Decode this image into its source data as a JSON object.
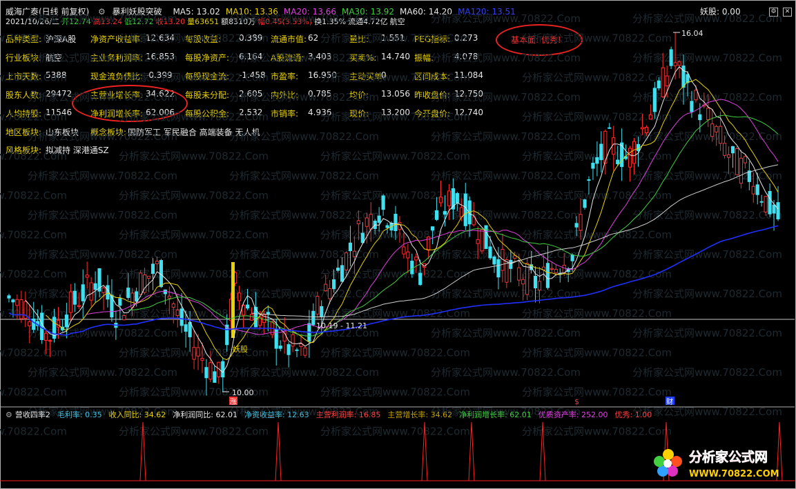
{
  "window": {
    "title": "威海广泰(日线 前复权)",
    "indicator_name": "暴利妖股突破",
    "ma_values": [
      {
        "label": "MA5: 13.02",
        "color": "#e8e8e8"
      },
      {
        "label": "MA10: 13.36",
        "color": "#e8d200"
      },
      {
        "label": "MA20: 13.66",
        "color": "#e040e0"
      },
      {
        "label": "MA30: 13.92",
        "color": "#40d040"
      },
      {
        "label": "MA60: 14.20",
        "color": "#e8e8e8"
      },
      {
        "label": "MA120: 13.51",
        "color": "#3040ff"
      }
    ],
    "yaogu_label": "妖股: 0.00"
  },
  "quote_line": [
    {
      "text": "2021/10/26/二",
      "color": "#e8e8e8"
    },
    {
      "text": "开12.74",
      "color": "#40d040"
    },
    {
      "text": "高13.24",
      "color": "#ff3030"
    },
    {
      "text": "低12.72",
      "color": "#40d040"
    },
    {
      "text": "收13.20",
      "color": "#ff3030"
    },
    {
      "text": "量63651",
      "color": "#e8d200"
    },
    {
      "text": "额8310万",
      "color": "#e8e8e8"
    },
    {
      "text": "幅0.45(3.53%)",
      "color": "#ff3030"
    },
    {
      "text": "换1.35%",
      "color": "#e8e8e8"
    },
    {
      "text": "流通4.72亿",
      "color": "#e8e8e8"
    },
    {
      "text": "航空",
      "color": "#e8e8e8"
    }
  ],
  "fundamentals": {
    "col1": [
      {
        "label": "品种类型:",
        "value": "沪深A股"
      },
      {
        "label": "行业板块:",
        "value": "航空"
      },
      {
        "label": "上市天数:",
        "value": "5388"
      },
      {
        "label": "股东人数:",
        "value": "29472"
      },
      {
        "label": "人均持股:",
        "value": "11546"
      }
    ],
    "col2": [
      {
        "label": "净资产收益率:",
        "value": "12.634"
      },
      {
        "label": "主业务利润率:",
        "value": "16.853"
      },
      {
        "label": "现金流负债比:",
        "value": "-0.399"
      },
      {
        "label": "主营业增长率:",
        "value": "34.622"
      },
      {
        "label": "净利润增长率:",
        "value": "62.006"
      }
    ],
    "col3": [
      {
        "label": "每股收益:",
        "value": "0.389"
      },
      {
        "label": "每股净资产:",
        "value": "6.164"
      },
      {
        "label": "每股现金流:",
        "value": "-1.458"
      },
      {
        "label": "每股未分配:",
        "value": "2.605"
      },
      {
        "label": "每股公积金:",
        "value": "2.532"
      }
    ],
    "col4": [
      {
        "label": "流通市值:",
        "value": "62"
      },
      {
        "label": "A股流通:",
        "value": "3.403"
      },
      {
        "label": "市盈率:",
        "value": "16.950"
      },
      {
        "label": "内外比:",
        "value": "0.785"
      },
      {
        "label": "市销率:",
        "value": "4.936"
      }
    ],
    "col5": [
      {
        "label": "量比:",
        "value": "1.551"
      },
      {
        "label": "买卖%:",
        "value": "14.740"
      },
      {
        "label": "主动买单:",
        "value": "0"
      },
      {
        "label": "均价:",
        "value": "13.056"
      },
      {
        "label": "现价:",
        "value": "13.200"
      }
    ],
    "col6": [
      {
        "label": "PEG指标:",
        "value": "0.273"
      },
      {
        "label": "振幅:",
        "value": "4.078"
      },
      {
        "label": "区间成本:",
        "value": "11.084"
      },
      {
        "label": "昨收盘价:",
        "value": "12.750"
      },
      {
        "label": "今开盘价:",
        "value": "12.740"
      }
    ],
    "region": {
      "label": "地区板块:",
      "value": "山东板块"
    },
    "concept": {
      "label": "概念板块:",
      "value": "国防军工 军民融合 高端装备 无人机"
    },
    "style": {
      "label": "风格板块:",
      "value": "拟减持 深港通SZ"
    },
    "verdict": "基本面: 优秀!"
  },
  "chart_labels": {
    "high_marker": "16.04",
    "low_marker": "10.00",
    "hline_label": "10.19 - 11.21",
    "yaogu_tag": "妖股",
    "tag_zhang": "涨",
    "tag_dollar": "$",
    "tag_cai": "财",
    "watermark": "分析家公式网www.70822.Com"
  },
  "sub_panel": {
    "title": "营收四率2",
    "items": [
      {
        "text": "毛利率: 0.35",
        "color": "#40c0e0"
      },
      {
        "text": "收入同比: 34.62",
        "color": "#e8d200"
      },
      {
        "text": "净利润同比: 62.01",
        "color": "#e8e8e8"
      },
      {
        "text": "净资收益率: 12.63",
        "color": "#40c0e0"
      },
      {
        "text": "主营利润率: 16.85",
        "color": "#ff4040"
      },
      {
        "text": "主营增长率: 34.62",
        "color": "#c0a000"
      },
      {
        "text": "净利润增长率: 62.01",
        "color": "#40d040"
      },
      {
        "text": "优质资产率: 252.00",
        "color": "#e040e0"
      },
      {
        "text": "优秀: 1.00",
        "color": "#ff4040"
      }
    ]
  },
  "logo": {
    "text": "分析家公式网",
    "url_text": "WWW.70822.COM"
  },
  "colors": {
    "up": "#ff3030",
    "down": "#40e0f0",
    "ma120": "#2030ff"
  }
}
